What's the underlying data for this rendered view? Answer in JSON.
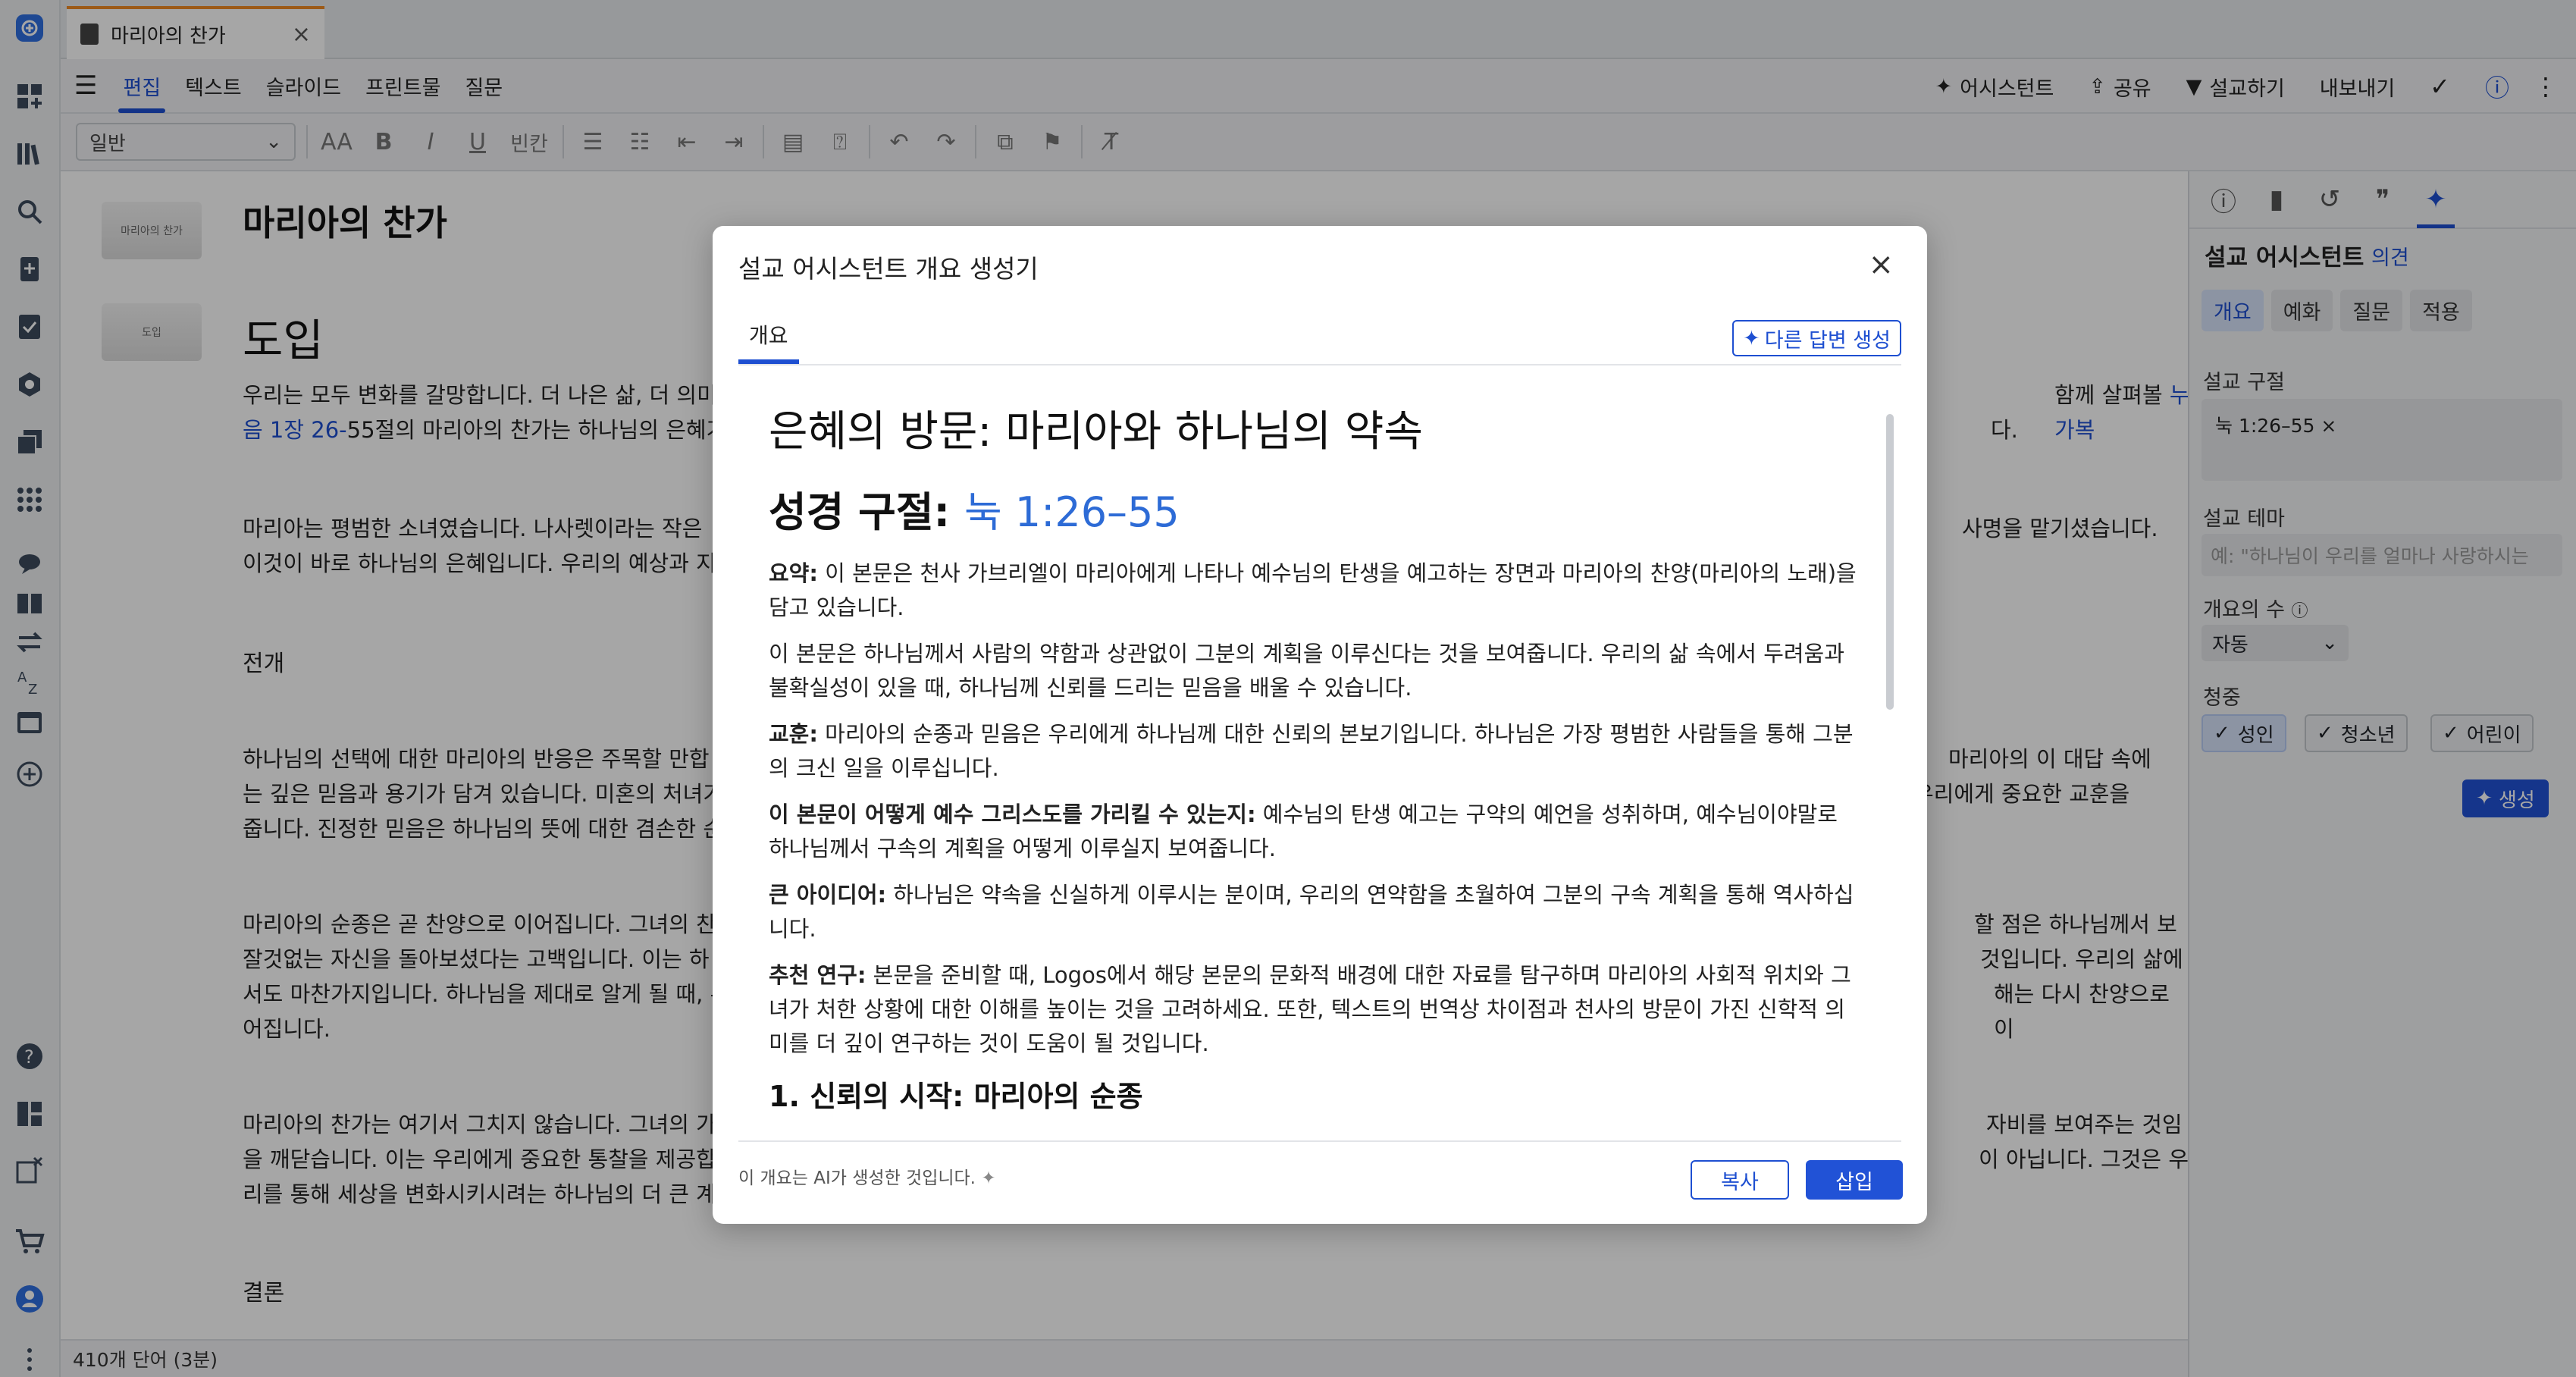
{
  "tab": {
    "title": "마리아의 찬가",
    "close": "×"
  },
  "menubar": {
    "items": [
      "편집",
      "텍스트",
      "슬라이드",
      "프린트물",
      "질문"
    ],
    "right": {
      "assistant": "어시스턴트",
      "share": "공유",
      "preach": "설교하기",
      "export": "내보내기"
    }
  },
  "toolbar": {
    "style": "일반",
    "blank": "빈칸"
  },
  "editor": {
    "thumb1": "마리아의 찬가",
    "thumb2": "도입",
    "title": "마리아의 찬가",
    "heading": "도입",
    "p1_a": "우리는 모두 변화를 갈망합니다. 더 나은 삶, 더 의미",
    "p1_b": "함께 살펴볼 ",
    "p1_ref1": "누가복",
    "p1_ref2": "음 1장 26-",
    "p1_c": "55절의 마리아의 찬가는 하나님의 은혜가",
    "p1_end": "다.",
    "p2_a": "마리아는 평범한 소녀였습니다. 나사렛이라는 작은",
    "p2_b": "사명을 맡기셨습니다.",
    "p2_c": "이것이 바로 하나님의 은혜입니다. 우리의 예상과 지",
    "s_dev": "전개",
    "p3_a": "하나님의 선택에 대한 마리아의 반응은 주목할 만합",
    "p3_b": "마리아의 이 대답 속에",
    "p3_c": "는 깊은 믿음과 용기가 담겨 있습니다. 미혼의 처녀가",
    "p3_d": "우리에게 중요한 교훈을",
    "p3_e": "줍니다. 진정한 믿음은 하나님의 뜻에 대한 겸손한 순",
    "p4_a": "마리아의 순종은 곧 찬양으로 이어집니다. 그녀의 찬",
    "p4_b": "할 점은 하나님께서 보",
    "p4_c": "잘것없는 자신을 돌아보셨다는 고백입니다. 이는 하",
    "p4_d": "것입니다. 우리의 삶에",
    "p4_e": "서도 마찬가지입니다. 하나님을 제대로 알게 될 때, 우",
    "p4_f": "해는 다시 찬양으로 이",
    "p4_g": "어집니다.",
    "p5_a": "마리아의 찬가는 여기서 그치지 않습니다. 그녀의 가",
    "p5_b": "자비를 보여주는 것임",
    "p5_c": "을 깨닫습니다. 이는 우리에게 중요한 통찰을 제공합",
    "p5_d": "이 아닙니다. 그것은 우",
    "p5_e": "리를 통해 세상을 변화시키시려는 하나님의 더 큰 계",
    "s_conc": "결론",
    "wordcount": "410개 단어 (3분)"
  },
  "right_panel": {
    "title": "설교 어시스턴트",
    "feedback": "의견",
    "tabs": [
      "개요",
      "예화",
      "질문",
      "적용"
    ],
    "passage_label": "설교 구절",
    "passage_chip": "눅 1:26–55",
    "theme_label": "설교 테마",
    "theme_placeholder": "예: \"하나님이 우리를 얼마나 사랑하시는",
    "count_label": "개요의 수",
    "count_value": "자동",
    "audience_label": "청중",
    "audience": [
      "성인",
      "청소년",
      "어린이"
    ],
    "generate": "생성"
  },
  "modal": {
    "title": "설교 어시스턴트 개요 생성기",
    "close": "×",
    "tab": "개요",
    "alt_button": "다른 답변 생성",
    "h1": "은혜의 방문: 마리아와 하나님의 약속",
    "h2_label": "성경 구절:",
    "h2_ref": "눅 1:26–55",
    "summary_label": "요약:",
    "summary": " 이 본문은 천사 가브리엘이 마리아에게 나타나 예수님의 탄생을 예고하는 장면과 마리아의 찬양(마리아의 노래)을 담고 있습니다.",
    "p2": "이 본문은 하나님께서 사람의 약함과 상관없이 그분의 계획을 이루신다는 것을 보여줍니다. 우리의 삶 속에서 두려움과 불확실성이 있을 때, 하나님께 신뢰를 드리는 믿음을 배울 수 있습니다.",
    "lesson_label": "교훈:",
    "lesson": " 마리아의 순종과 믿음은 우리에게 하나님께 대한 신뢰의 본보기입니다. 하나님은 가장 평범한 사람들을 통해 그분의 크신 일을 이루십니다.",
    "christ_label": "이 본문이 어떻게 예수 그리스도를 가리킬 수 있는지:",
    "christ": " 예수님의 탄생 예고는 구약의 예언을 성취하며, 예수님이야말로 하나님께서 구속의 계획을 어떻게 이루실지 보여줍니다.",
    "idea_label": "큰 아이디어:",
    "idea": " 하나님은 약속을 신실하게 이루시는 분이며, 우리의 연약함을 초월하여 그분의 구속 계획을 통해 역사하십니다.",
    "study_label": "추천 연구:",
    "study": " 본문을 준비할 때, Logos에서 해당 본문의 문화적 배경에 대한 자료를 탐구하며 마리아의 사회적 위치와 그녀가 처한 상황에 대한 이해를 높이는 것을 고려하세요. 또한, 텍스트의 번역상 차이점과 천사의 방문이 가진 신학적 의미를 더 깊이 연구하는 것이 도움이 될 것입니다.",
    "h3": "1. 신뢰의 시작: 마리아의 순종",
    "ai_note": "이 개요는 AI가 생성한 것입니다.",
    "copy": "복사",
    "insert": "삽입"
  },
  "colors": {
    "accent": "#1e4fd1",
    "tab_accent": "#f08a24"
  }
}
